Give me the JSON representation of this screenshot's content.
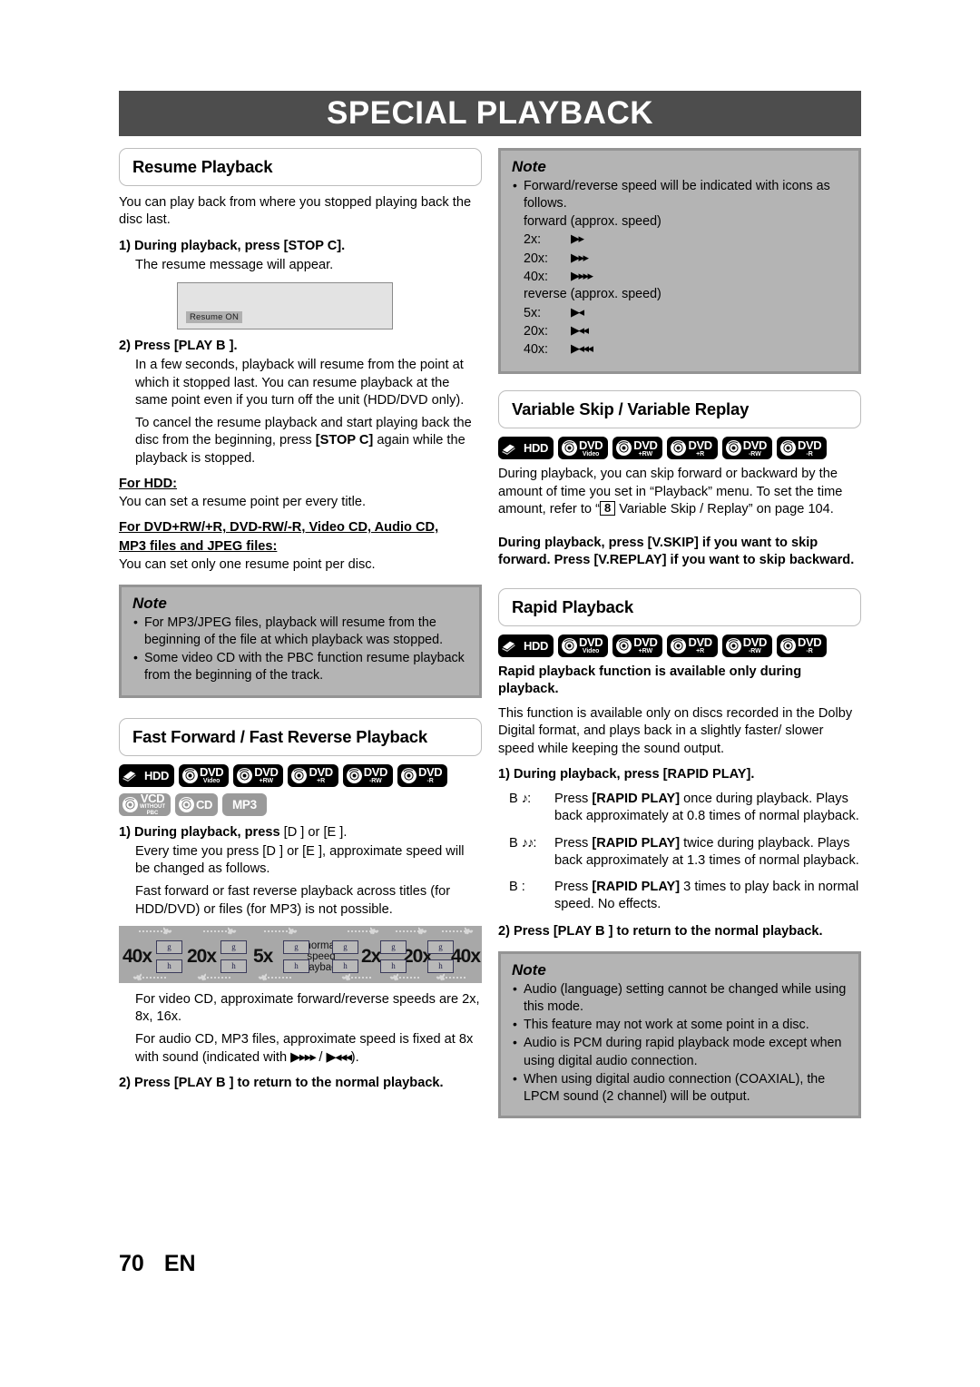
{
  "banner": {
    "title": "SPECIAL PLAYBACK"
  },
  "footer": {
    "page": "70",
    "lang": "EN"
  },
  "resume": {
    "heading": "Resume Playback",
    "intro": "You can play back from where you stopped playing back the disc last.",
    "step1_num": "1)",
    "step1": "During playback, press [STOP C].",
    "step1_sub": "The resume message will appear.",
    "osd_label": "Resume ON",
    "step2_num": "2)",
    "step2": "Press [PLAY B ].",
    "step2_sub1": "In a few seconds, playback will resume from the point at which it stopped last. You can resume playback at the same point even if you turn off the unit (HDD/DVD only).",
    "step2_sub2_a": "To cancel the resume playback and start playing back the disc from the beginning, press ",
    "step2_sub2_b": "[STOP C]",
    "step2_sub2_c": " again while the playback is stopped.",
    "hdd_head": "For HDD:",
    "hdd_text": "You can set a resume point per every title.",
    "disc_head_l1": "For DVD+RW/+R, DVD-RW/-R, Video CD, Audio CD,",
    "disc_head_l2": "MP3 files and JPEG files:",
    "disc_text": "You can set only one resume point per disc.",
    "note": {
      "title": "Note",
      "items": [
        "For MP3/JPEG files, playback will resume from the beginning of the file at which playback was stopped.",
        "Some video CD with the PBC function resume playback from the beginning of the track."
      ]
    }
  },
  "fastfwd": {
    "heading": "Fast Forward / Fast Reverse Playback",
    "badges_row1": [
      {
        "kind": "hdd",
        "t1": "HDD"
      },
      {
        "kind": "disc",
        "t1": "DVD",
        "t2": "Video"
      },
      {
        "kind": "disc",
        "t1": "DVD",
        "t2": "+RW"
      },
      {
        "kind": "disc",
        "t1": "DVD",
        "t2": "+R"
      },
      {
        "kind": "disc",
        "t1": "DVD",
        "t2": "-RW"
      },
      {
        "kind": "disc",
        "t1": "DVD",
        "t2": "-R"
      }
    ],
    "badges_row2": [
      {
        "kind": "disc-gray",
        "t1": "VCD",
        "t3a": "WITHOUT",
        "t3b": "PBC"
      },
      {
        "kind": "disc-gray",
        "t1": "CD"
      },
      {
        "kind": "plain-gray",
        "t1": "MP3"
      }
    ],
    "step1_num": "1)",
    "step1_a": "During playback, press ",
    "step1_b": "[D  ] or [E  ].",
    "sub1": "Every time you press [D  ] or [E  ], approximate speed will be changed as follows.",
    "sub2": "Fast forward or fast reverse playback across titles (for HDD/DVD) or files (for MP3) is not possible.",
    "diagram": {
      "labels": [
        "40x",
        "20x",
        "5x",
        "2x",
        "20x",
        "40x"
      ],
      "center_l1": "normal",
      "center_l2": "speed",
      "center_l3": "playback",
      "box_top": "g",
      "box_bottom": "h"
    },
    "sub3": "For video CD, approximate forward/reverse speeds are 2x, 8x, 16x.",
    "sub4_a": "For audio CD, MP3 files, approximate speed is fixed at 8x with sound (indicated with ",
    "sub4_icon1": "▶▸▸▸",
    "sub4_mid": " / ",
    "sub4_icon2": "▶◂◂◂",
    "sub4_b": ").",
    "step2_num": "2)",
    "step2": "Press [PLAY B ] to return to the normal playback."
  },
  "note_speed": {
    "title": "Note",
    "bullet": "Forward/reverse speed will be indicated with icons as follows.",
    "forward_label": "forward (approx. speed)",
    "forward": [
      {
        "label": "2x:",
        "icon": "▶▸"
      },
      {
        "label": "20x:",
        "icon": "▶▸▸"
      },
      {
        "label": "40x:",
        "icon": "▶▸▸▸"
      }
    ],
    "reverse_label": "reverse (approx. speed)",
    "reverse": [
      {
        "label": "5x:",
        "icon": "▶◂"
      },
      {
        "label": "20x:",
        "icon": "▶◂◂"
      },
      {
        "label": "40x:",
        "icon": "▶◂◂◂"
      }
    ]
  },
  "vskip": {
    "heading": "Variable Skip / Variable Replay",
    "badges": [
      {
        "kind": "hdd",
        "t1": "HDD"
      },
      {
        "kind": "disc",
        "t1": "DVD",
        "t2": "Video"
      },
      {
        "kind": "disc",
        "t1": "DVD",
        "t2": "+RW"
      },
      {
        "kind": "disc",
        "t1": "DVD",
        "t2": "+R"
      },
      {
        "kind": "disc",
        "t1": "DVD",
        "t2": "-RW"
      },
      {
        "kind": "disc",
        "t1": "DVD",
        "t2": "-R"
      }
    ],
    "body_a": "During playback, you can skip forward or backward by the amount of time you set in “Playback” menu. To set the time amount, refer to “",
    "body_num": "8",
    "body_b": " Variable Skip / Replay” on page 104.",
    "instruction": "During playback, press [V.SKIP] if you want to skip forward. Press [V.REPLAY] if you want to skip backward."
  },
  "rapid": {
    "heading": "Rapid Playback",
    "badges": [
      {
        "kind": "hdd",
        "t1": "HDD"
      },
      {
        "kind": "disc",
        "t1": "DVD",
        "t2": "Video"
      },
      {
        "kind": "disc",
        "t1": "DVD",
        "t2": "+RW"
      },
      {
        "kind": "disc",
        "t1": "DVD",
        "t2": "+R"
      },
      {
        "kind": "disc",
        "t1": "DVD",
        "t2": "-RW"
      },
      {
        "kind": "disc",
        "t1": "DVD",
        "t2": "-R"
      }
    ],
    "avail_l1": "Rapid playback function is available only during",
    "avail_l2": "playback.",
    "desc": "This function is available only on discs recorded in the Dolby Digital format, and plays back in a slightly faster/ slower speed while keeping the sound output.",
    "step1_num": "1)",
    "step1": "During playback, press [RAPID PLAY].",
    "rows": [
      {
        "key_b": "B",
        "key_notes": "♪",
        "key_colon": ":",
        "pre": "Press ",
        "bold": "[RAPID PLAY]",
        "post": " once during playback. Plays back approximately at 0.8 times of normal playback."
      },
      {
        "key_b": "B",
        "key_notes": "♪♪",
        "key_colon": ":",
        "pre": "Press ",
        "bold": "[RAPID PLAY]",
        "post": " twice during playback. Plays back approximately at 1.3 times of normal playback."
      },
      {
        "key_b": "B",
        "key_notes": "",
        "key_colon": ":",
        "pre": "Press ",
        "bold": "[RAPID PLAY]",
        "post": " 3 times to play back in normal speed. No effects."
      }
    ],
    "step2_num": "2)",
    "step2": "Press [PLAY B ] to return to the normal playback.",
    "note": {
      "title": "Note",
      "items": [
        "Audio (language) setting cannot be changed while using this mode.",
        "This feature may not work at some point in a disc.",
        "Audio is PCM during rapid playback mode except when using digital audio connection.",
        "When using digital audio connection (COAXIAL), the LPCM sound (2 channel) will be output."
      ]
    }
  }
}
